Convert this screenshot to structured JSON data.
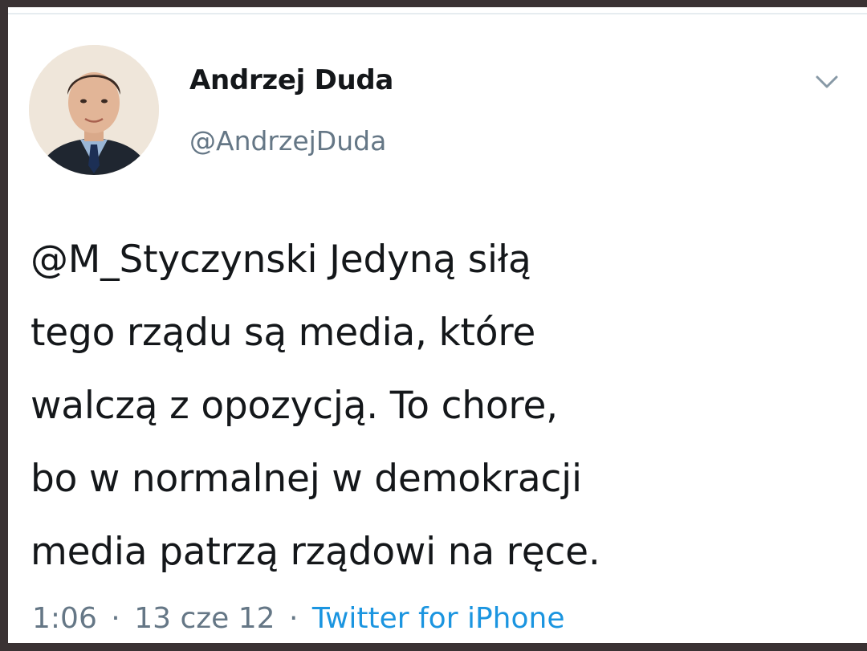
{
  "tweet": {
    "author": {
      "display_name": "Andrzej Duda",
      "handle": "@AndrzejDuda"
    },
    "menu_icon": "chevron-down-icon",
    "text_lines": [
      "@M_Styczynski Jedyną siłą",
      "tego rządu są media, które",
      "walczą z opozycją. To chore,",
      "bo w normalnej w demokracji",
      "media patrzą rządowi na ręce."
    ],
    "meta": {
      "time": "1:06",
      "separator": "·",
      "date": "13 cze 12",
      "source": "Twitter for iPhone"
    }
  },
  "colors": {
    "frame": "#3a3233",
    "text": "#14171a",
    "secondary": "#657786",
    "link": "#1b95e0"
  }
}
